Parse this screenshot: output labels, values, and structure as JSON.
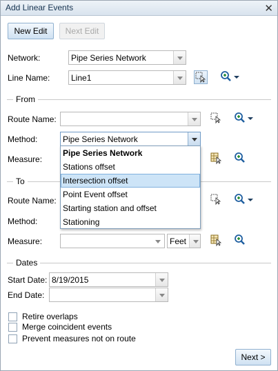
{
  "window": {
    "title": "Add Linear Events"
  },
  "toolbar": {
    "new_edit": "New Edit",
    "next_edit": "Next Edit"
  },
  "network": {
    "label": "Network:",
    "value": "Pipe Series Network"
  },
  "line_name": {
    "label": "Line Name:",
    "value": "Line1"
  },
  "from": {
    "section": "From",
    "route_label": "Route Name:",
    "route_value": "",
    "method_label": "Method:",
    "method_value": "Pipe Series Network",
    "measure_label": "Measure:"
  },
  "method_options": [
    "Pipe Series Network",
    "Stations offset",
    "Intersection offset",
    "Point Event offset",
    "Starting station and offset",
    "Stationing"
  ],
  "to": {
    "section": "To",
    "route_label": "Route Name:",
    "method_label": "Method:",
    "measure_label": "Measure:",
    "measure_value": "",
    "units": "Feet"
  },
  "dates": {
    "section": "Dates",
    "start_label": "Start Date:",
    "start_value": "8/19/2015",
    "end_label": "End Date:",
    "end_value": ""
  },
  "options": {
    "retire": "Retire overlaps",
    "merge": "Merge coincident events",
    "prevent": "Prevent measures not on route"
  },
  "next_button": "Next >"
}
